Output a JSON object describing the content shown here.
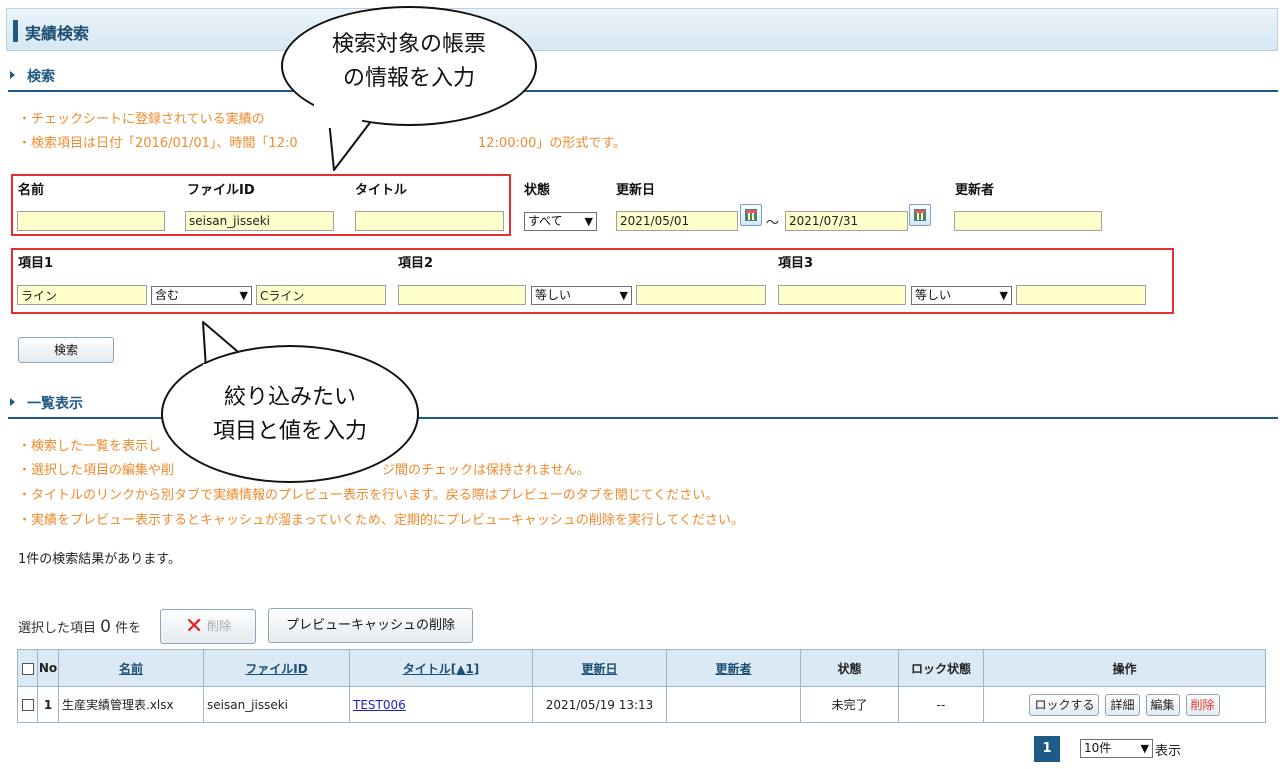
{
  "header": {
    "title": "実績検索"
  },
  "search": {
    "section_title": "検索",
    "notes": [
      "・チェックシートに登録されている実績の",
      "・検索項目は日付「2016/01/01」、時間「12:0",
      "12:00:00」の形式です。"
    ],
    "labels": {
      "name": "名前",
      "file_id": "ファイルID",
      "title": "タイトル",
      "status": "状態",
      "updated_date": "更新日",
      "updater": "更新者",
      "item1": "項目1",
      "item2": "項目2",
      "item3": "項目3"
    },
    "values": {
      "name": "",
      "file_id": "seisan_jisseki",
      "title": "",
      "status": "すべて",
      "date_from": "2021/05/01",
      "date_tilde": "～",
      "date_to": "2021/07/31",
      "updater": "",
      "item1_value": "ライン",
      "item1_op": "含む",
      "item1_target": "Cライン",
      "item2_value": "",
      "item2_op": "等しい",
      "item2_target": "",
      "item3_value": "",
      "item3_op": "等しい",
      "item3_target": ""
    },
    "search_button": "検索"
  },
  "list": {
    "section_title": "一覧表示",
    "notes": [
      "・検索した一覧を表示し",
      "・選択した項目の編集や削",
      "ジ間のチェックは保持されません。",
      "・タイトルのリンクから別タブで実績情報のプレビュー表示を行います。戻る際はプレビューのタブを閉じてください。",
      "・実績をプレビュー表示するとキャッシュが溜まっていくため、定期的にプレビューキャッシュの削除を実行してください。"
    ],
    "result_count": "1件の検索結果があります。",
    "selected_prefix": "選択した項目",
    "selected_count": "0",
    "selected_suffix": "件を",
    "delete_button": "削除",
    "clear_cache_button": "プレビューキャッシュの削除",
    "columns": [
      "No",
      "名前",
      "ファイルID",
      "タイトル[▲1]",
      "更新日",
      "更新者",
      "状態",
      "ロック状態",
      "操作"
    ],
    "rows": [
      {
        "no": "1",
        "name": "生産実績管理表.xlsx",
        "file_id": "seisan_jisseki",
        "title": "TEST006",
        "updated": "2021/05/19 13:13",
        "updater": "",
        "status": "未完了",
        "lock": "--",
        "ops": [
          "ロックする",
          "詳細",
          "編集",
          "削除"
        ]
      }
    ],
    "pagination": {
      "current_page": "1",
      "per_page": "10件",
      "per_page_suffix": "表示"
    }
  },
  "callouts": {
    "top": [
      "検索対象の帳票",
      "の情報を入力"
    ],
    "bottom": [
      "絞り込みたい",
      "項目と値を入力"
    ]
  },
  "colors": {
    "accent": "#1d5a85",
    "note": "#f08a2b",
    "highlight_box": "#e03030",
    "input_bg": "#ffffcc"
  }
}
